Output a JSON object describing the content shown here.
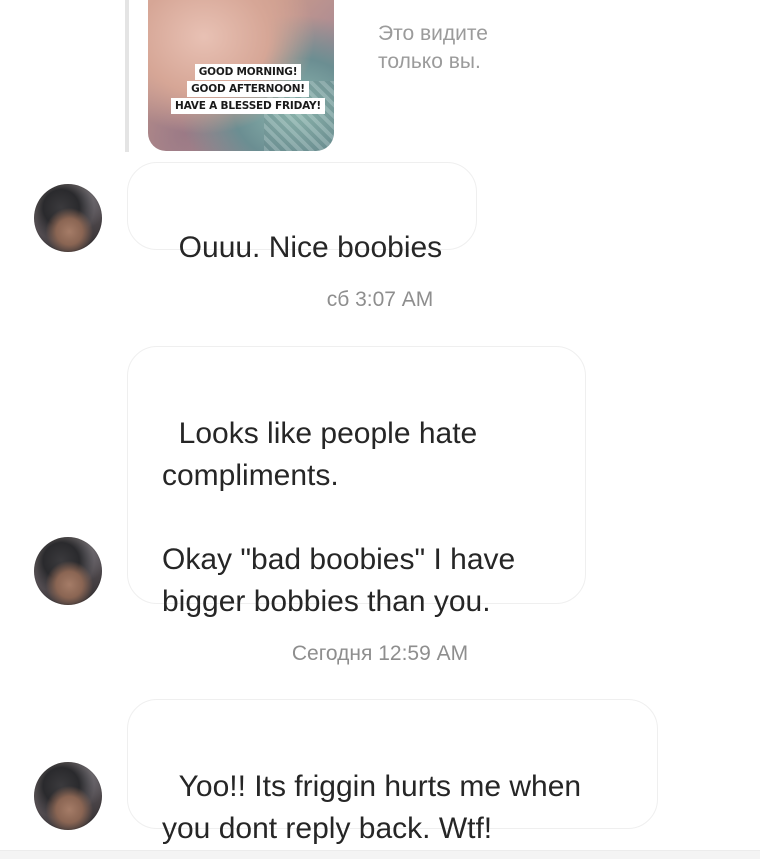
{
  "story_reply": {
    "caption_lines": [
      "GOOD MORNING!",
      "GOOD AFTERNOON!",
      "HAVE A BLESSED FRIDAY!"
    ],
    "visibility_note": "Это видите только вы."
  },
  "messages": [
    {
      "text": "Ouuu. Nice boobies"
    },
    {
      "text": "Looks like people hate compliments.\n\nOkay \"bad boobies\" I have bigger bobbies than you."
    },
    {
      "text": "Yoo!! Its friggin hurts me when you dont reply back. Wtf!"
    }
  ],
  "timestamps": [
    "сб 3:07 AM",
    "Сегодня 12:59 AM"
  ]
}
